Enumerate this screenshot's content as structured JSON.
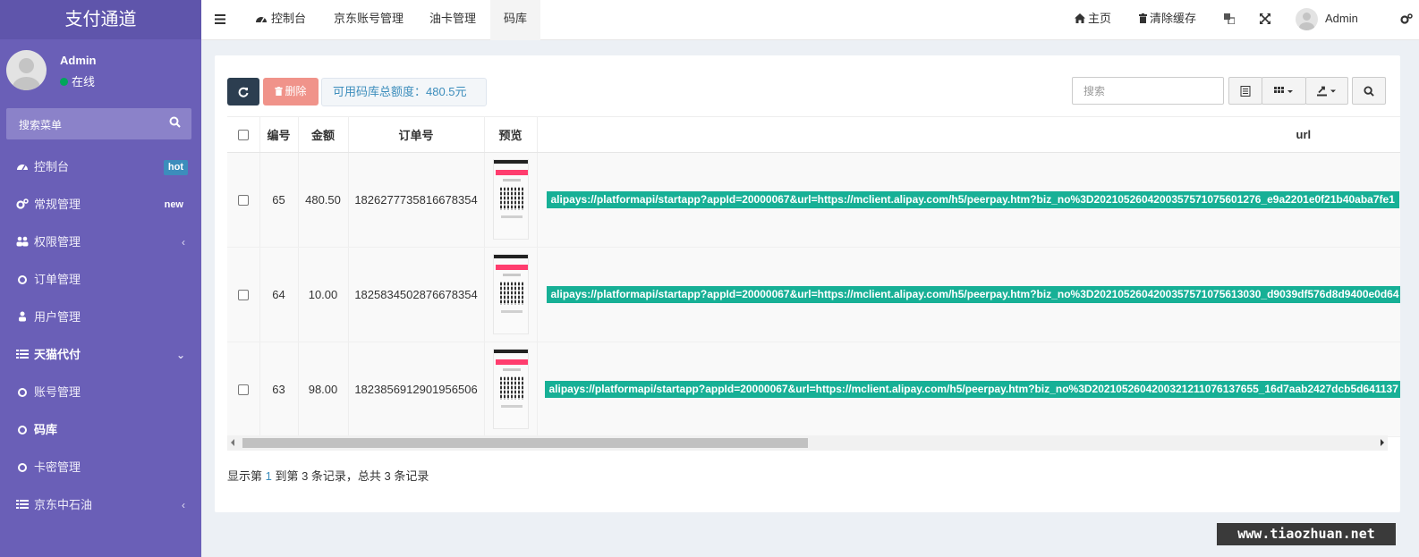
{
  "sidebar": {
    "logo": "支付通道",
    "user": {
      "name": "Admin",
      "status": "在线"
    },
    "search_placeholder": "搜索菜单",
    "items": [
      {
        "label": "控制台",
        "icon": "dashboard-icon",
        "badge": "hot"
      },
      {
        "label": "常规管理",
        "icon": "cogs-icon",
        "badge": "new"
      },
      {
        "label": "权限管理",
        "icon": "users-icon",
        "arrow": "‹"
      },
      {
        "label": "订单管理",
        "icon": "circle-icon"
      },
      {
        "label": "用户管理",
        "icon": "user-icon"
      },
      {
        "label": "天猫代付",
        "icon": "list-icon",
        "arrow": "⌄"
      },
      {
        "label": "账号管理",
        "icon": "circle-icon"
      },
      {
        "label": "码库",
        "icon": "circle-icon",
        "active": true
      },
      {
        "label": "卡密管理",
        "icon": "circle-icon"
      },
      {
        "label": "京东中石油",
        "icon": "list-icon",
        "arrow": "‹"
      }
    ]
  },
  "topnav": {
    "tabs": [
      {
        "label": "控制台",
        "icon": "dashboard-icon"
      },
      {
        "label": "京东账号管理"
      },
      {
        "label": "油卡管理"
      },
      {
        "label": "码库",
        "active": true
      }
    ],
    "home_label": "主页",
    "clear_cache_label": "清除缓存",
    "user_name": "Admin"
  },
  "toolbar": {
    "delete_label": "删除",
    "quota_label": "可用码库总额度：480.5元",
    "search_placeholder": "搜索"
  },
  "table": {
    "columns": [
      "编号",
      "金额",
      "订单号",
      "预览",
      "url"
    ],
    "rows": [
      {
        "id": "65",
        "amount": "480.50",
        "order_no": "1826277735816678354",
        "url": "alipays://platformapi/startapp?appId=20000067&url=https://mclient.alipay.com/h5/peerpay.htm?biz_no%3D2021052604200357571075601276_e9a2201e0f21b40aba7fe1"
      },
      {
        "id": "64",
        "amount": "10.00",
        "order_no": "1825834502876678354",
        "url": "alipays://platformapi/startapp?appId=20000067&url=https://mclient.alipay.com/h5/peerpay.htm?biz_no%3D2021052604200357571075613030_d9039df576d8d9400e0d64"
      },
      {
        "id": "63",
        "amount": "98.00",
        "order_no": "1823856912901956506",
        "url": "alipays://platformapi/startapp?appId=20000067&url=https://mclient.alipay.com/h5/peerpay.htm?biz_no%3D2021052604200321211076137655_16d7aab2427dcb5d641137"
      }
    ]
  },
  "pagination": {
    "prefix": "显示第 ",
    "from": "1",
    "middle": " 到第 3 条记录，总共 3 条记录"
  },
  "watermark": "www.tiaozhuan.net",
  "colors": {
    "sidebar": "#6a5fb7",
    "accent": "#3c8dbc",
    "url_label": "#17b096",
    "delete": "#f0938a",
    "refresh": "#2c3e50"
  }
}
